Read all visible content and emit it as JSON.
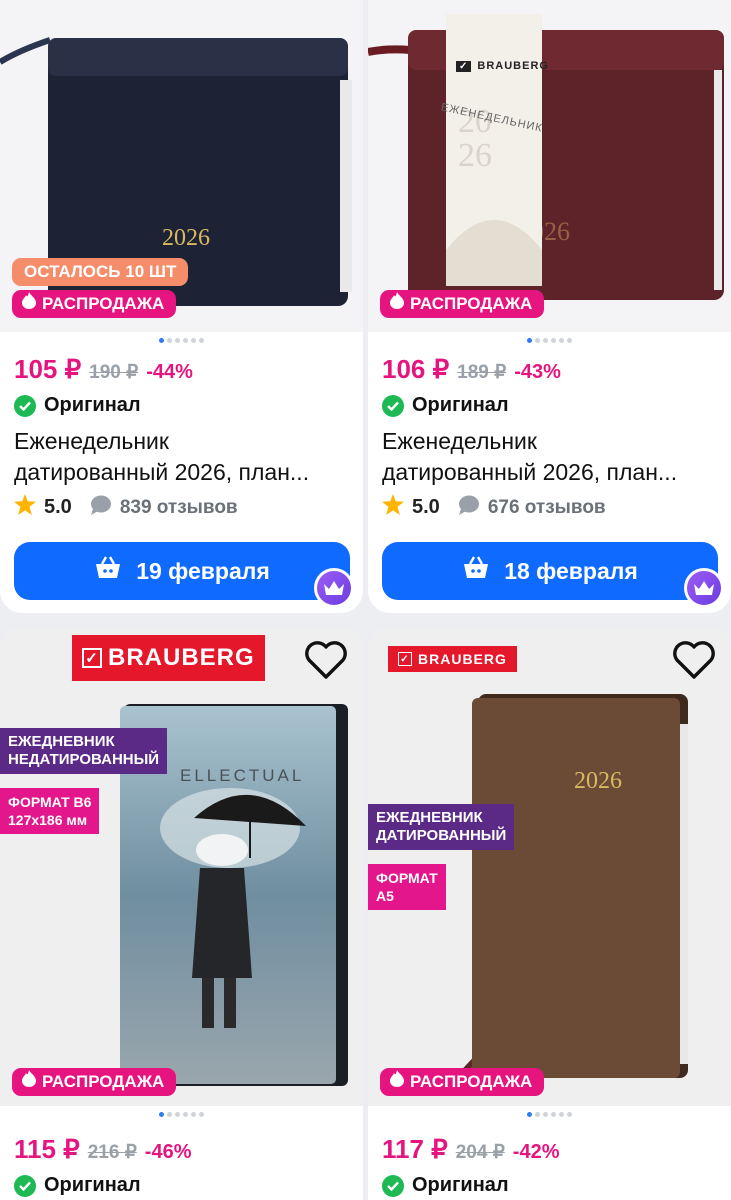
{
  "products": [
    {
      "stock_badge": "ОСТАЛОСЬ 10 ШТ",
      "sale_badge": "РАСПРОДАЖА",
      "price": "105 ₽",
      "old_price": "190 ₽",
      "discount": "-44%",
      "original_label": "Оригинал",
      "title_line1": "Еженедельник",
      "title_line2": "датированный 2026, план...",
      "rating": "5.0",
      "reviews": "839 отзывов",
      "delivery": "19 февраля",
      "cover_year": "2026",
      "cover_color": "#1c2233"
    },
    {
      "sale_badge": "РАСПРОДАЖА",
      "price": "106 ₽",
      "old_price": "189 ₽",
      "discount": "-43%",
      "original_label": "Оригинал",
      "title_line1": "Еженедельник",
      "title_line2": "датированный 2026, план...",
      "rating": "5.0",
      "reviews": "676 отзывов",
      "delivery": "18 февраля",
      "cover_year": "2026",
      "brand": "BRAUBERG",
      "band_title": "ЕЖЕНЕДЕЛЬНИК",
      "cover_color": "#5e2328"
    },
    {
      "brand": "BRAUBERG",
      "tag1_line1": "ЕЖЕДНЕВНИК",
      "tag1_line2": "НЕДАТИРОВАННЫЙ",
      "tag2_line1": "ФОРМАТ B6",
      "tag2_line2": "127x186 мм",
      "cover_text": "ELLECTUAL",
      "sale_badge": "РАСПРОДАЖА",
      "price": "115 ₽",
      "old_price": "216 ₽",
      "discount": "-46%",
      "original_label": "Оригинал"
    },
    {
      "brand": "BRAUBERG",
      "tag1_line1": "ЕЖЕДНЕВНИК",
      "tag1_line2": "ДАТИРОВАННЫЙ",
      "tag2_line1": "ФОРМАТ",
      "tag2_line2": "A5",
      "cover_year": "2026",
      "sale_badge": "РАСПРОДАЖА",
      "price": "117 ₽",
      "old_price": "204 ₽",
      "discount": "-42%",
      "original_label": "Оригинал",
      "cover_color": "#6b4a36"
    }
  ],
  "colors": {
    "accent": "#e6147f",
    "button": "#0f6bff",
    "original_check": "#1db954"
  },
  "icons": [
    "fire-icon",
    "check-icon",
    "star-icon",
    "chat-bubble-icon",
    "basket-icon",
    "crown-icon",
    "heart-icon"
  ]
}
